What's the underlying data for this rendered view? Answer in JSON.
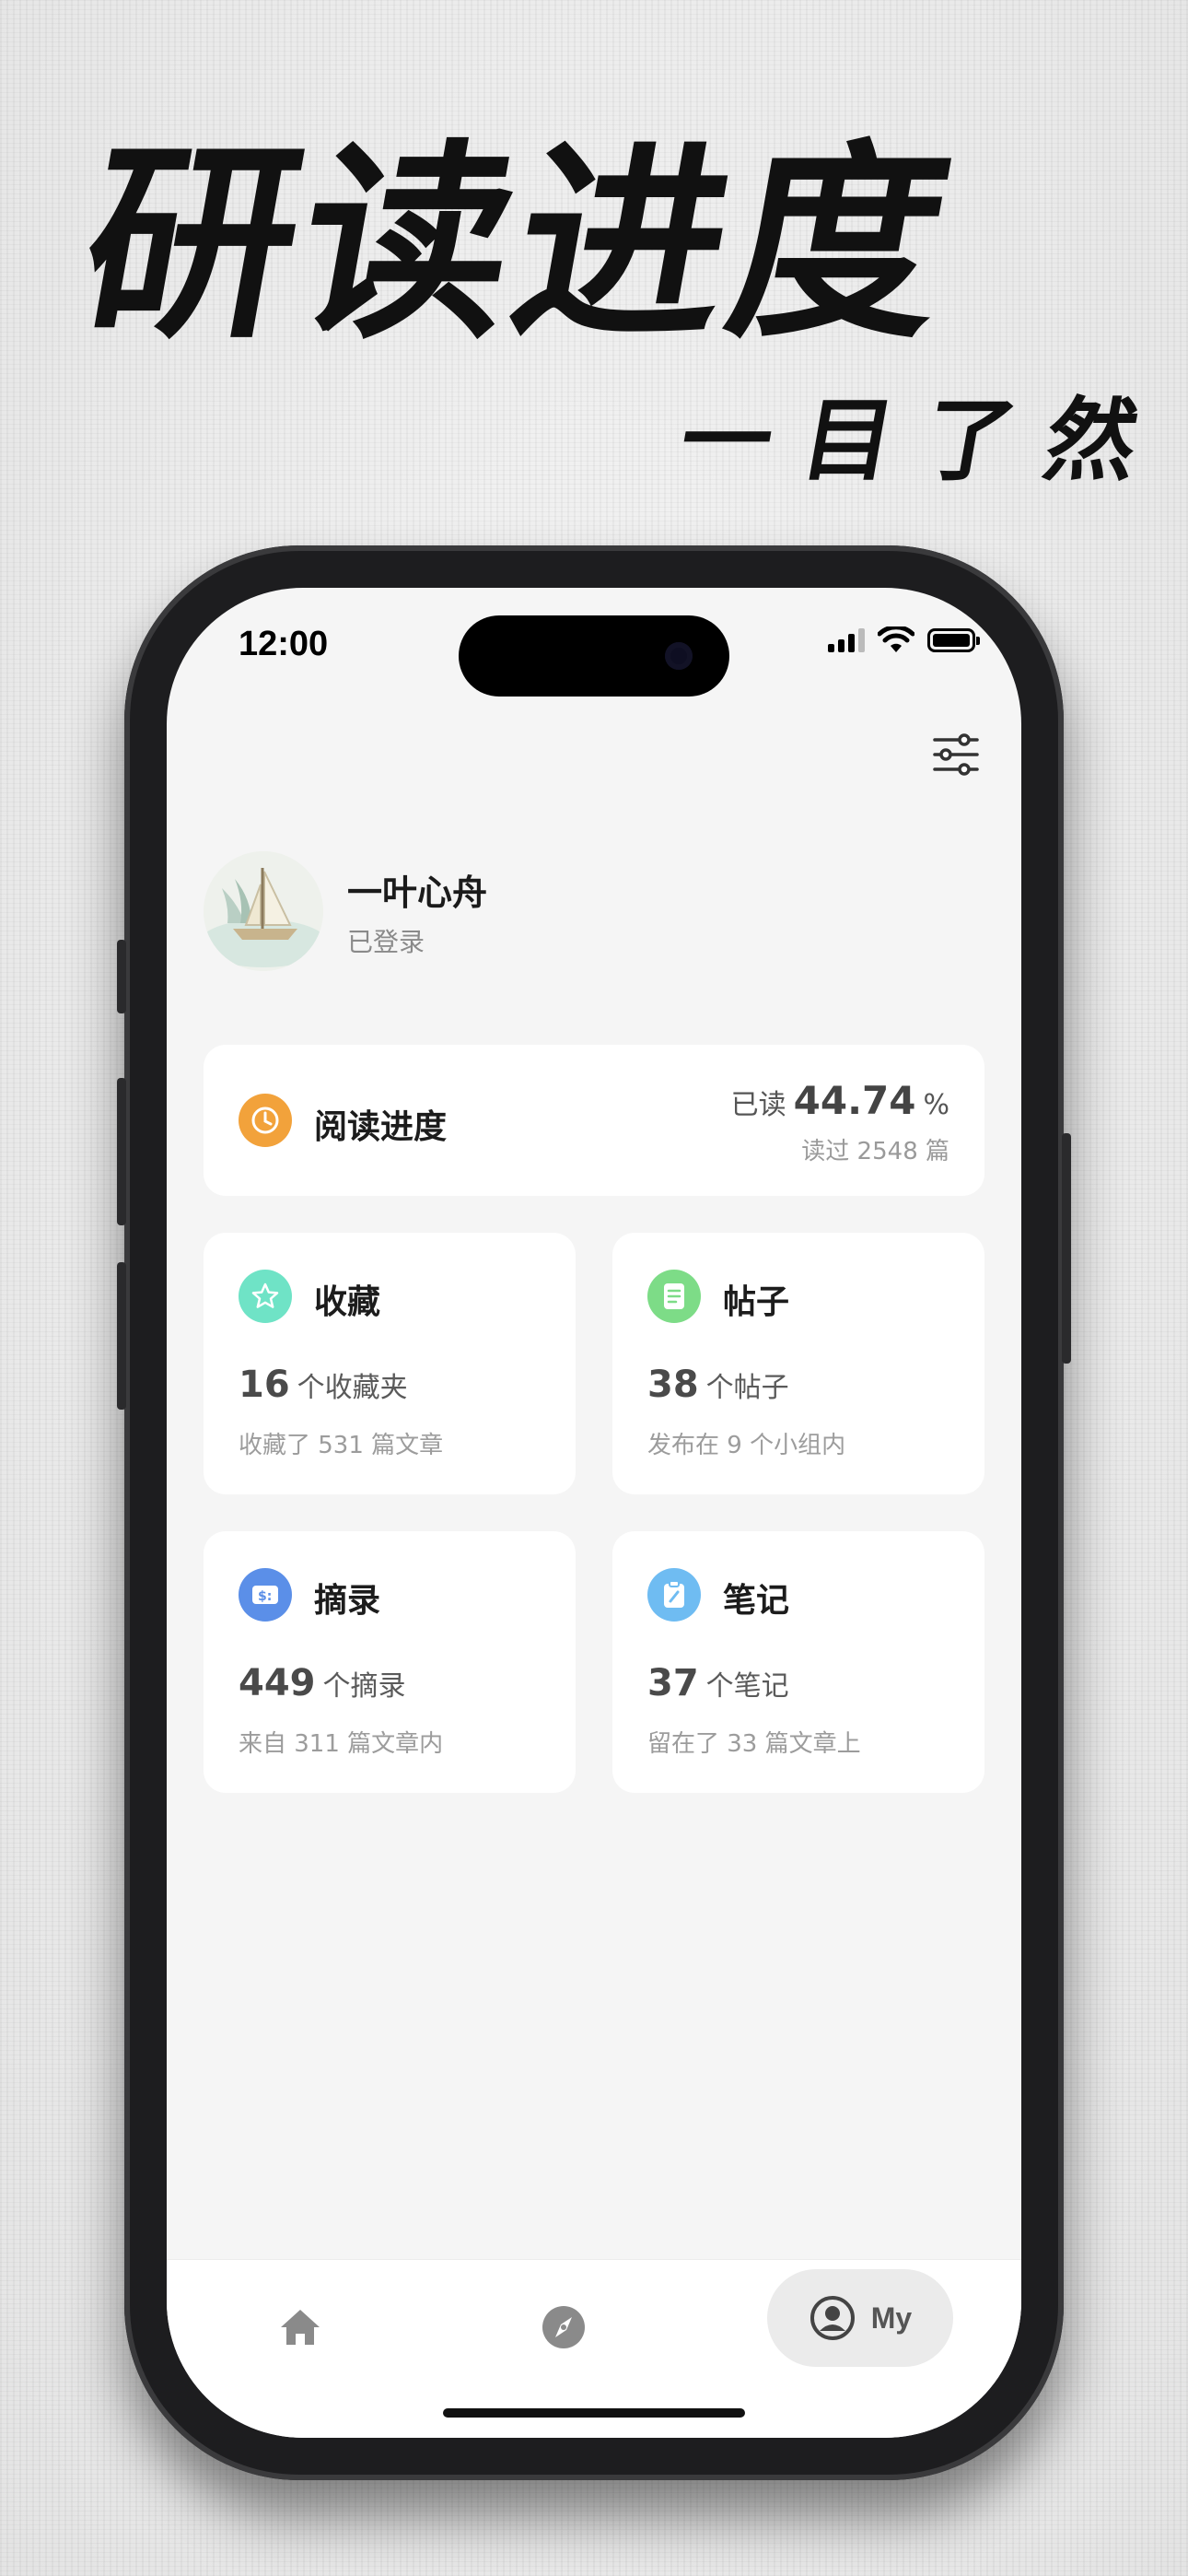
{
  "promo": {
    "headline": "研读进度",
    "subline": "一目了然"
  },
  "status_bar": {
    "time": "12:00"
  },
  "profile": {
    "name": "一叶心舟",
    "status": "已登录"
  },
  "reading_progress": {
    "title": "阅读进度",
    "read_prefix": "已读",
    "percent": "44.74",
    "percent_unit": "%",
    "count_text": "读过 2548 篇",
    "icon": "clock-icon",
    "icon_color": "#f2a23b"
  },
  "stats": [
    {
      "title": "收藏",
      "number": "16",
      "unit": "个收藏夹",
      "sub": "收藏了 531 篇文章",
      "icon": "star-icon",
      "icon_color": "#6fe3c6"
    },
    {
      "title": "帖子",
      "number": "38",
      "unit": "个帖子",
      "sub": "发布在 9 个小组内",
      "icon": "document-icon",
      "icon_color": "#7ddc87"
    },
    {
      "title": "摘录",
      "number": "449",
      "unit": "个摘录",
      "sub": "来自 311 篇文章内",
      "icon": "excerpt-icon",
      "icon_color": "#5b8fe8"
    },
    {
      "title": "笔记",
      "number": "37",
      "unit": "个笔记",
      "sub": "留在了 33 篇文章上",
      "icon": "note-icon",
      "icon_color": "#6fbcf2"
    }
  ],
  "tabbar": {
    "home_icon": "home-icon",
    "discover_icon": "compass-icon",
    "my_label": "My"
  }
}
